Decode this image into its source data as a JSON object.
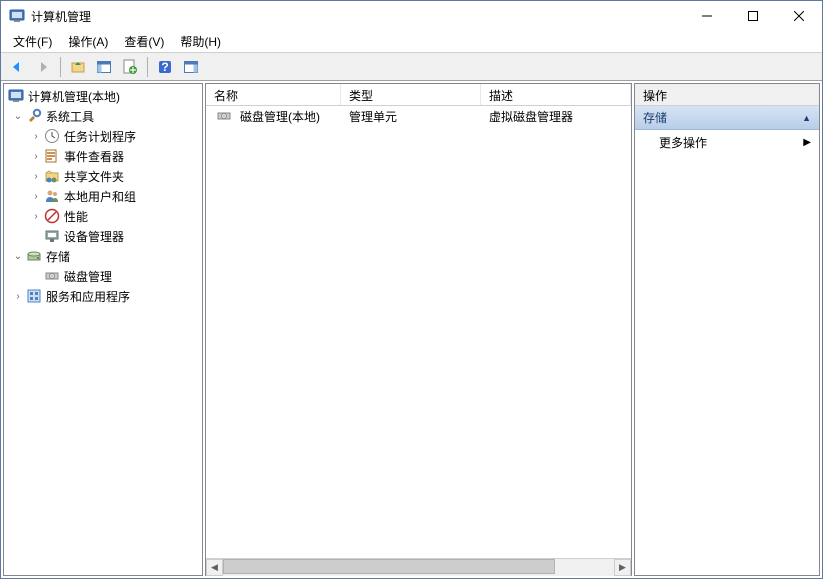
{
  "window": {
    "title": "计算机管理"
  },
  "menu": {
    "file": "文件(F)",
    "action": "操作(A)",
    "view": "查看(V)",
    "help": "帮助(H)"
  },
  "tree": {
    "root": "计算机管理(本地)",
    "systools": "系统工具",
    "task": "任务计划程序",
    "event": "事件查看器",
    "shared": "共享文件夹",
    "users": "本地用户和组",
    "perf": "性能",
    "devmgr": "设备管理器",
    "storage": "存储",
    "disk": "磁盘管理",
    "services": "服务和应用程序"
  },
  "list": {
    "col_name": "名称",
    "col_type": "类型",
    "col_desc": "描述",
    "row_name": "磁盘管理(本地)",
    "row_type": "管理单元",
    "row_desc": "虚拟磁盘管理器"
  },
  "actions": {
    "header": "操作",
    "section": "存储",
    "more": "更多操作"
  }
}
